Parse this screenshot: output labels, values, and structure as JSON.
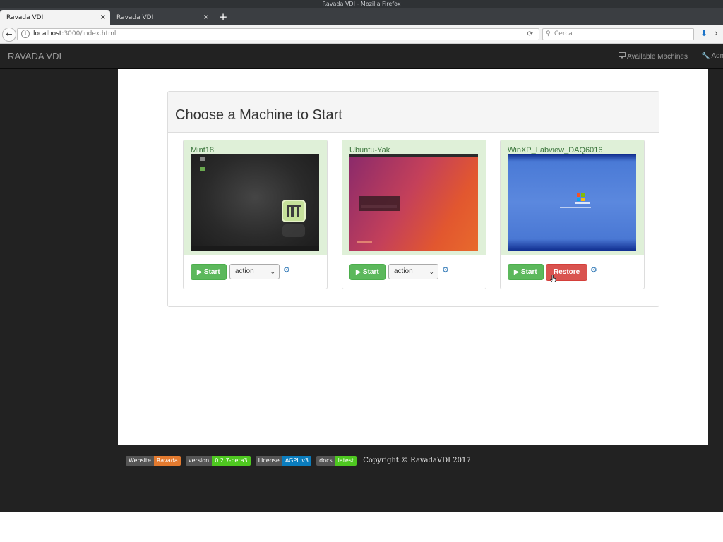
{
  "browser": {
    "window_title": "Ravada VDI - Mozilla Firefox",
    "tabs": [
      {
        "label": "Ravada VDI",
        "close": "×"
      },
      {
        "label": "Ravada VDI",
        "close": "×"
      }
    ],
    "new_tab": "+",
    "url_host": "localhost",
    "url_path": ":3000/index.html",
    "search_placeholder": "Cerca",
    "icons": {
      "back": "back-arrow-icon",
      "info": "info-icon",
      "reload": "reload-icon",
      "search": "search-icon",
      "download": "download-icon"
    }
  },
  "app": {
    "brand": "RAVADA VDI",
    "nav": {
      "machines": "Available Machines",
      "admin": "Adm"
    },
    "panel_title": "Choose a Machine to Start",
    "machines": [
      {
        "name": "Mint18",
        "start": "Start",
        "action": "action"
      },
      {
        "name": "Ubuntu-Yak",
        "start": "Start",
        "action": "action"
      },
      {
        "name": "WinXP_Labview_DAQ6016",
        "start": "Start",
        "restore": "Restore"
      }
    ],
    "footer": {
      "badges": [
        {
          "key": "Website",
          "value": "Ravada",
          "color": "#e37a2f"
        },
        {
          "key": "version",
          "value": "0.2.7-beta3",
          "color": "#4ec820"
        },
        {
          "key": "License",
          "value": "AGPL v3",
          "color": "#0b7dbe"
        },
        {
          "key": "docs",
          "value": "latest",
          "color": "#4ec820"
        }
      ],
      "copyright": "Copyright © RavadaVDI 2017"
    },
    "colors": {
      "navbar": "#222222",
      "success": "#5cb85c",
      "danger": "#d9534f",
      "card_head": "#dff0d8",
      "link": "#337ab7"
    }
  }
}
